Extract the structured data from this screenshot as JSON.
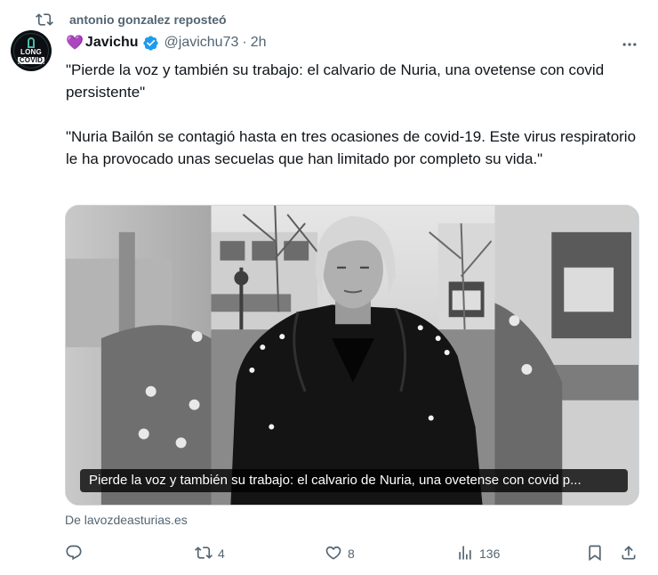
{
  "repost": {
    "icon": "repost-icon",
    "text": "antonio gonzalez reposteó"
  },
  "author": {
    "avatar_icon": "long-covid-avatar",
    "avatar_line1": "LONG",
    "avatar_line2": "COVID",
    "emoji": "💜",
    "name": "Javichu",
    "verified_icon": "verified-badge-icon",
    "handle": "@javichu73",
    "separator": "·",
    "time": "2h"
  },
  "more_icon": "more-options-icon",
  "text": {
    "paragraph1": "\"Pierde la voz y también su trabajo: el calvario de Nuria, una ovetense con covid persistente\"",
    "paragraph2": "\"Nuria Bailón se contagió hasta en tres ocasiones de covid-19. Este virus respiratorio le ha provocado unas secuelas que han limitado por completo su vida.\""
  },
  "card": {
    "caption": "Pierde la voz y también su trabajo: el calvario de Nuria, una ovetense con covid p...",
    "source": "De lavozdeasturias.es"
  },
  "actions": {
    "reply": {
      "icon": "reply-icon",
      "count": ""
    },
    "repost": {
      "icon": "repost-icon",
      "count": "4",
      "color": "#536471"
    },
    "like": {
      "icon": "heart-icon",
      "count": "8"
    },
    "views": {
      "icon": "views-icon",
      "count": "136"
    },
    "bookmark": {
      "icon": "bookmark-icon"
    },
    "share": {
      "icon": "share-icon"
    }
  },
  "colors": {
    "text_primary": "#0f1419",
    "text_secondary": "#536471",
    "verified": "#1d9bf0",
    "border": "#cfd9de"
  }
}
